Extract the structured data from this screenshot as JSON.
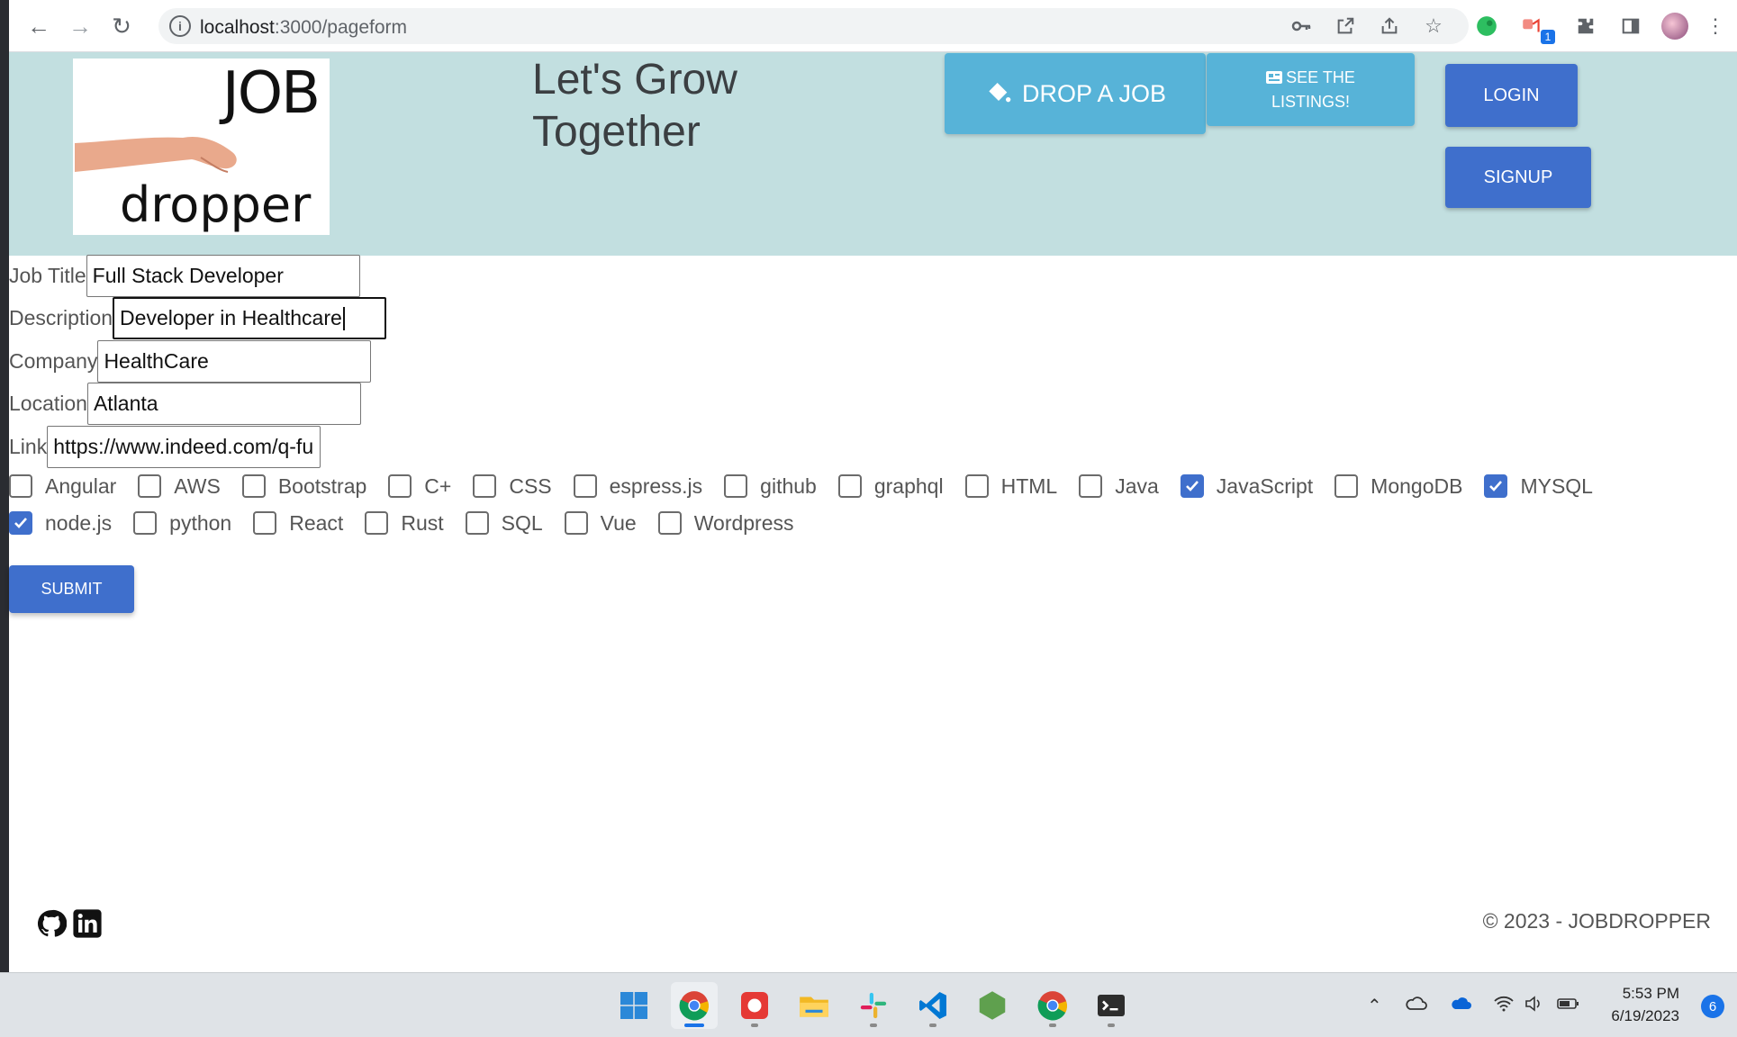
{
  "browser": {
    "url_host": "localhost",
    "url_rest": ":3000/pageform",
    "extension_badge": "1"
  },
  "header": {
    "logo_word_top": "JOB",
    "logo_word_bottom": "dropper",
    "tagline": "Let's Grow Together",
    "drop_job_label": "DROP A JOB",
    "listings_label": "SEE THE LISTINGS!",
    "login_label": "LOGIN",
    "signup_label": "SIGNUP"
  },
  "form": {
    "job_title_label": "Job Title",
    "job_title_value": "Full Stack Developer",
    "description_label": "Description",
    "description_value": "Developer in Healthcare",
    "company_label": "Company",
    "company_value": "HealthCare",
    "location_label": "Location",
    "location_value": "Atlanta",
    "link_label": "Link",
    "link_value": "https://www.indeed.com/q-fu",
    "skills_row1": [
      {
        "label": "Angular",
        "checked": false
      },
      {
        "label": "AWS",
        "checked": false
      },
      {
        "label": "Bootstrap",
        "checked": false
      },
      {
        "label": "C+",
        "checked": false
      },
      {
        "label": "CSS",
        "checked": false
      },
      {
        "label": "espress.js",
        "checked": false
      },
      {
        "label": "github",
        "checked": false
      },
      {
        "label": "graphql",
        "checked": false
      },
      {
        "label": "HTML",
        "checked": false
      },
      {
        "label": "Java",
        "checked": false
      },
      {
        "label": "JavaScript",
        "checked": true
      },
      {
        "label": "MongoDB",
        "checked": false
      },
      {
        "label": "MYSQL",
        "checked": true
      }
    ],
    "skills_row2": [
      {
        "label": "node.js",
        "checked": true
      },
      {
        "label": "python",
        "checked": false
      },
      {
        "label": "React",
        "checked": false
      },
      {
        "label": "Rust",
        "checked": false
      },
      {
        "label": "SQL",
        "checked": false
      },
      {
        "label": "Vue",
        "checked": false
      },
      {
        "label": "Wordpress",
        "checked": false
      }
    ],
    "submit_label": "SUBMIT"
  },
  "footer": {
    "copyright": "© 2023 - JOBDROPPER"
  },
  "taskbar": {
    "time": "5:53 PM",
    "date": "6/19/2023",
    "notification_count": "6"
  }
}
